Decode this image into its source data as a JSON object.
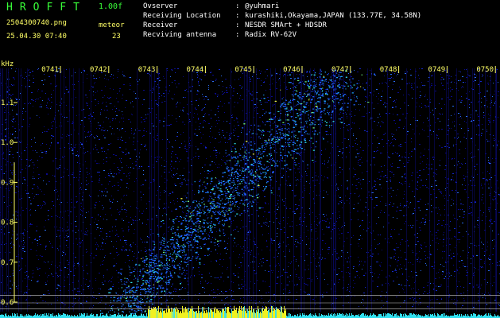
{
  "header": {
    "title": "HROFFT",
    "version": "1.00f",
    "filename": "2504300740.png",
    "mode": "meteor",
    "datetime": "25.04.30 07:40",
    "count": "23"
  },
  "info": [
    {
      "key": "Ovserver",
      "value": "@yuhmari"
    },
    {
      "key": "Receiving Location",
      "value": "kurashiki,Okayama,JAPAN (133.77E, 34.58N)"
    },
    {
      "key": "Receiver",
      "value": "NESDR SMArt + HDSDR"
    },
    {
      "key": "Recviving antenna",
      "value": "Radix RV-62V"
    }
  ],
  "spectrogram": {
    "unit": "kHz",
    "time_ticks": [
      "0741",
      "0742",
      "0743",
      "0744",
      "0745",
      "0746",
      "0747",
      "0748",
      "0749",
      "0750"
    ],
    "freq_ticks": [
      "1.1",
      "1.0",
      "0.9",
      "0.8",
      "0.7",
      "0.6"
    ],
    "ref_lines_khz": [
      0.617,
      0.598,
      0.583
    ],
    "colors": {
      "bg": "#000000",
      "label": "#ffff66",
      "title": "#39ff39"
    }
  }
}
